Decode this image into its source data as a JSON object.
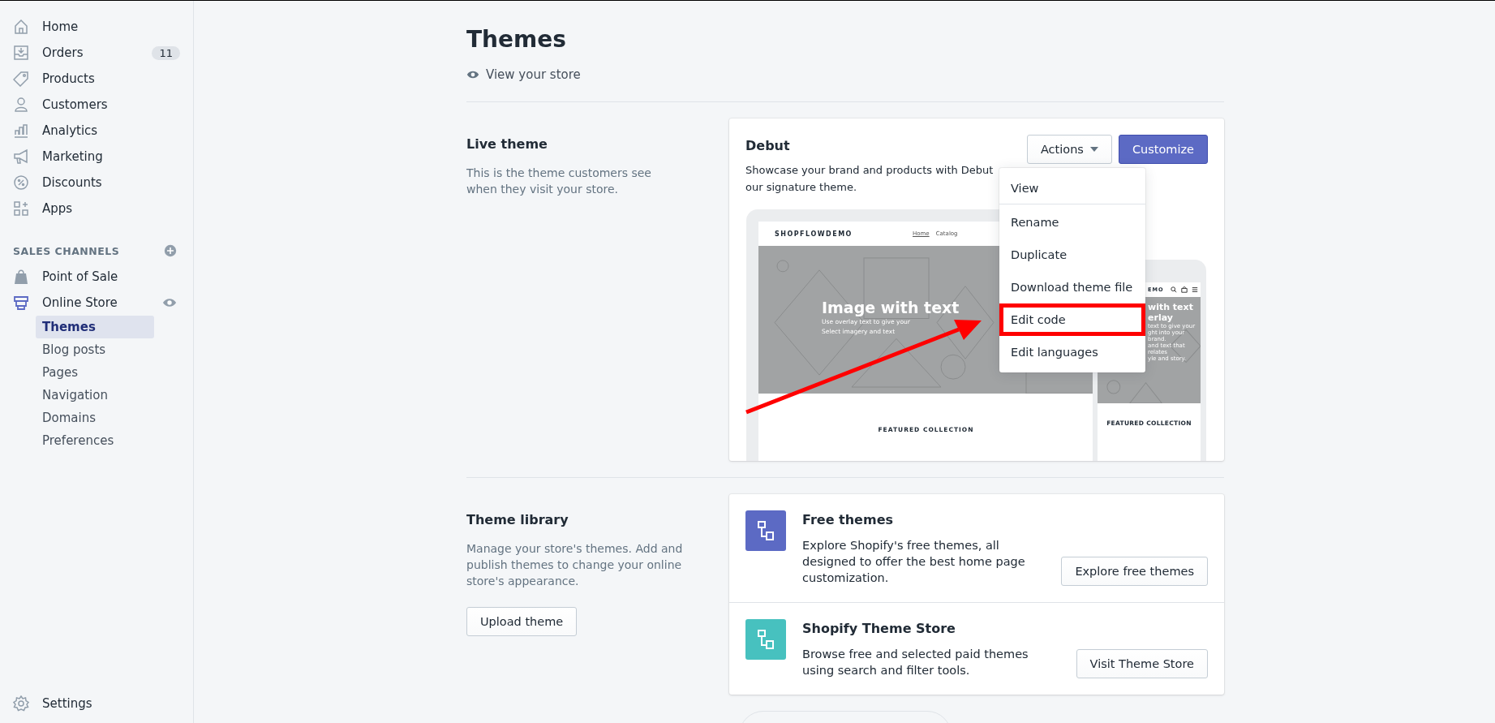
{
  "sidebar": {
    "nav": [
      {
        "label": "Home"
      },
      {
        "label": "Orders",
        "badge": "11"
      },
      {
        "label": "Products"
      },
      {
        "label": "Customers"
      },
      {
        "label": "Analytics"
      },
      {
        "label": "Marketing"
      },
      {
        "label": "Discounts"
      },
      {
        "label": "Apps"
      }
    ],
    "sales_channels": {
      "heading": "SALES CHANNELS",
      "items": [
        {
          "label": "Point of Sale",
          "expanded": false
        },
        {
          "label": "Online Store",
          "expanded": true,
          "children": [
            {
              "label": "Themes",
              "selected": true
            },
            {
              "label": "Blog posts",
              "selected": false
            },
            {
              "label": "Pages",
              "selected": false
            },
            {
              "label": "Navigation",
              "selected": false
            },
            {
              "label": "Domains",
              "selected": false
            },
            {
              "label": "Preferences",
              "selected": false
            }
          ]
        }
      ]
    },
    "settings": "Settings"
  },
  "page": {
    "title": "Themes",
    "view_store": "View your store"
  },
  "live_theme": {
    "heading": "Live theme",
    "description": "This is the theme customers see when they visit your store.",
    "card": {
      "name": "Debut",
      "description": [
        "Showcase your brand and products with Debut",
        "our signature theme."
      ],
      "actions_button": "Actions",
      "customize_button": "Customize",
      "menu": [
        {
          "label": "View",
          "highlighted": false
        },
        {
          "label": "Rename",
          "highlighted": false
        },
        {
          "label": "Duplicate",
          "highlighted": false
        },
        {
          "label": "Download theme file",
          "highlighted": false
        },
        {
          "label": "Edit code",
          "highlighted": true
        },
        {
          "label": "Edit languages",
          "highlighted": false
        }
      ],
      "preview": {
        "desktop": {
          "logo": "SHOPFLOWDEMO",
          "nav": [
            {
              "label": "Home",
              "selected": true
            },
            {
              "label": "Catalog",
              "selected": false
            }
          ],
          "hero_title": "Image with text",
          "hero_lines": [
            "Use overlay text to give your",
            "Select imagery and text"
          ],
          "section": "FEATURED COLLECTION"
        },
        "mobile": {
          "logo": "EMO",
          "hero_title": [
            "with text",
            "erlay"
          ],
          "hero_lines": [
            "text to give your",
            "ght into your brand.",
            "and text that relates",
            "yle and story."
          ],
          "section": "FEATURED COLLECTION"
        }
      }
    }
  },
  "theme_library": {
    "heading": "Theme library",
    "description": "Manage your store's themes. Add and publish themes to change your online store's appearance.",
    "upload_button": "Upload theme",
    "items": [
      {
        "title": "Free themes",
        "description": "Explore Shopify's free themes, all designed to offer the best home page customization.",
        "button": "Explore free themes",
        "color": "#5c6ac4"
      },
      {
        "title": "Shopify Theme Store",
        "description": "Browse free and selected paid themes using search and filter tools.",
        "button": "Visit Theme Store",
        "color": "#47c1bf"
      }
    ]
  }
}
